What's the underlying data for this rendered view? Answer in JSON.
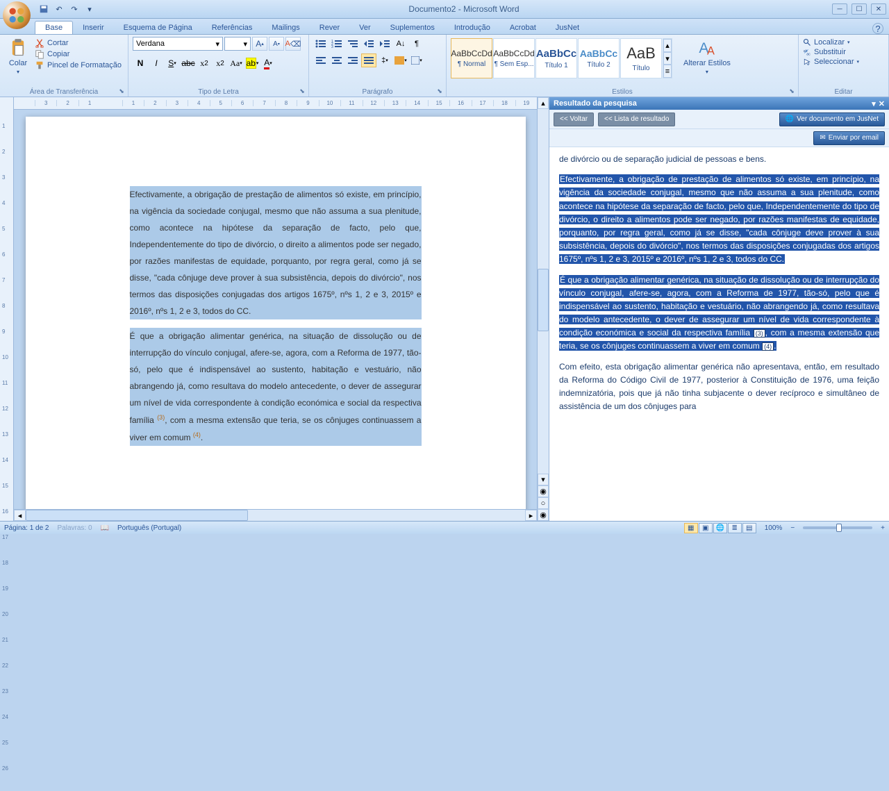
{
  "title": "Documento2 - Microsoft Word",
  "tabs": [
    "Base",
    "Inserir",
    "Esquema de Página",
    "Referências",
    "Mailings",
    "Rever",
    "Ver",
    "Suplementos",
    "Introdução",
    "Acrobat",
    "JusNet"
  ],
  "active_tab": 0,
  "clipboard": {
    "paste": "Colar",
    "cut": "Cortar",
    "copy": "Copiar",
    "painter": "Pincel de Formatação",
    "label": "Área de Transferência"
  },
  "font": {
    "name": "Verdana",
    "size": "",
    "label": "Tipo de Letra"
  },
  "paragraph": {
    "label": "Parágrafo"
  },
  "styles": {
    "label": "Estilos",
    "change": "Alterar Estilos",
    "items": [
      {
        "preview": "AaBbCcDd",
        "name": "¶ Normal"
      },
      {
        "preview": "AaBbCcDd",
        "name": "¶ Sem Esp..."
      },
      {
        "preview": "AaBbCc",
        "name": "Título 1"
      },
      {
        "preview": "AaBbCc",
        "name": "Título 2"
      },
      {
        "preview": "AaB",
        "name": "Título"
      }
    ]
  },
  "editing": {
    "label": "Editar",
    "find": "Localizar",
    "replace": "Substituir",
    "select": "Seleccionar"
  },
  "ruler_h": [
    "3",
    "2",
    "1",
    "",
    "1",
    "2",
    "3",
    "4",
    "5",
    "6",
    "7",
    "8",
    "9",
    "10",
    "11",
    "12",
    "13",
    "14",
    "15",
    "16",
    "17",
    "18",
    "19"
  ],
  "ruler_v": [
    "",
    "1",
    "2",
    "3",
    "4",
    "5",
    "6",
    "7",
    "8",
    "9",
    "10",
    "11",
    "12",
    "13",
    "14",
    "15",
    "16",
    "17",
    "18",
    "19",
    "20",
    "21",
    "22",
    "23",
    "24",
    "25",
    "26"
  ],
  "document": {
    "p1": "Efectivamente, a obrigação de prestação de alimentos só existe, em princípio, na vigência da sociedade conjugal, mesmo que não assuma a sua plenitude, como acontece na hipótese da separação de facto, pelo que, Independentemente do tipo de divórcio, o direito a alimentos pode ser negado, por razões manifestas de equidade, porquanto, por regra geral, como já se disse, \"cada cônjuge deve prover à sua subsistência, depois do divórcio\", nos termos das disposições conjugadas dos artigos 1675º, nºs 1, 2 e 3, 2015º e 2016º, nºs 1, 2 e 3, todos do CC.",
    "p2a": "É que a obrigação alimentar genérica, na situação de dissolução ou de interrupção do vínculo conjugal, afere-se, agora, com a Reforma de 1977, tão-só, pelo que é indispensável ao sustento, habitação e vestuário, não abrangendo já, como resultava do modelo antecedente, o dever de assegurar um nível de vida correspondente à condição económica e social da respectiva família ",
    "p2b": ", com a mesma extensão que teria, se os cônjuges continuassem a viver em comum ",
    "ref3": "(3)",
    "ref4": "(4)",
    "dot": "."
  },
  "side_panel": {
    "title": "Resultado da pesquisa",
    "back": "<< Voltar",
    "list": "<< Lista de resultado",
    "view_doc": "Ver documento em JusNet",
    "email": "Enviar por email",
    "intro": "de divórcio ou de separação judicial de pessoas e bens.",
    "hl1": "Efectivamente, a obrigação de prestação de alimentos só existe, em princípio, na vigência da sociedade conjugal, mesmo que não assuma a sua plenitude, como acontece na hipótese da separação de facto, pelo que, Independentemente do tipo de divórcio, o direito a alimentos pode ser negado, por razões manifestas de equidade, porquanto, por regra geral, como já se disse, \"cada cônjuge deve prover à sua subsistência, depois do divórcio\", nos termos das disposições conjugadas dos artigos 1675º, nºs 1, 2 e 3, 2015º e 2016º, nºs 1, 2 e 3, todos do CC.",
    "hl2a": "É que a obrigação alimentar genérica, na situação de dissolução ou de interrupção do vínculo conjugal, afere-se, agora, com a Reforma de 1977, tão-só, pelo que é indispensável ao sustento, habitação e vestuário, não abrangendo já, como resultava do modelo antecedente, o dever de assegurar um nível de vida correspondente à condição económica e social da respectiva família ",
    "hl2b": ", com a mesma extensão que teria, se os cônjuges continuassem a viver em comum ",
    "hl2c": ".",
    "p3": "Com efeito, esta obrigação alimentar genérica não apresentava, então, em resultado da Reforma do Código Civil de 1977, posterior à Constituição de 1976, uma feição indemnizatória, pois que já não tinha subjacente o dever recíproco e simultâneo de assistência de um dos cônjuges para"
  },
  "status": {
    "page": "Página: 1 de 2",
    "words": "Palavras: 0",
    "lang": "Português (Portugal)",
    "zoom": "100%"
  }
}
